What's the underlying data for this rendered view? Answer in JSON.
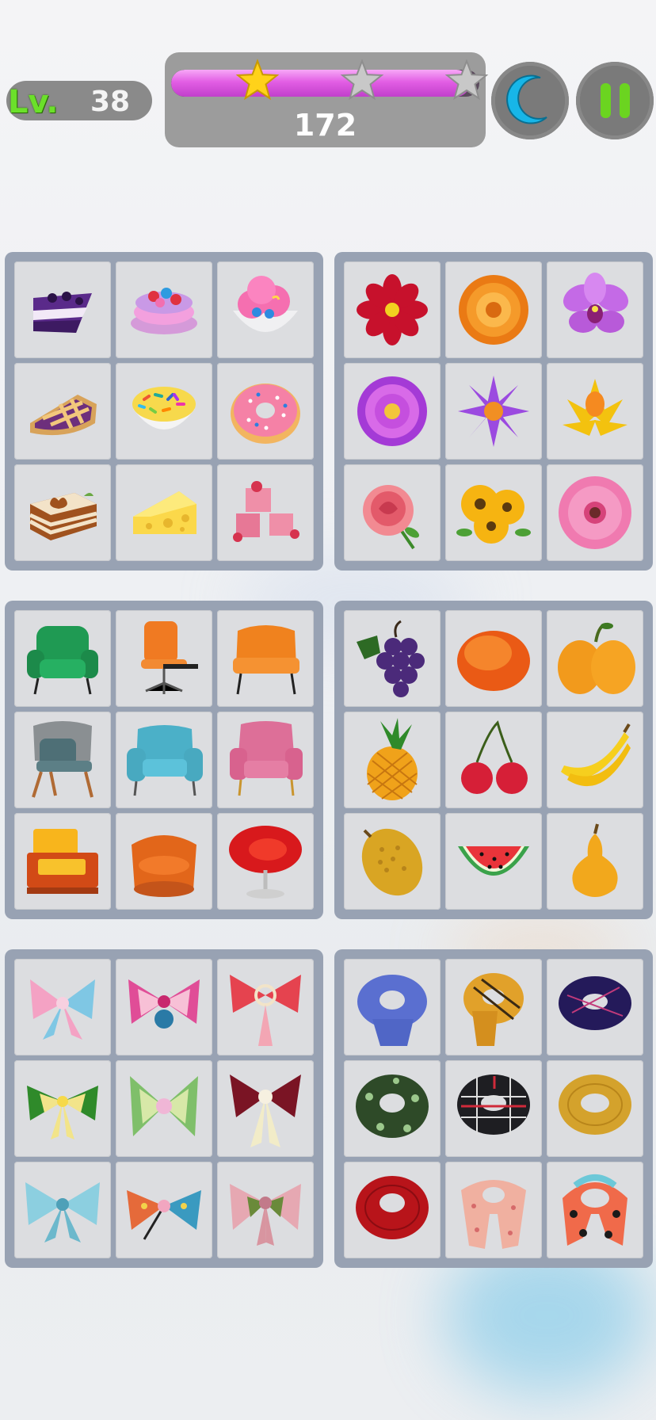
{
  "hud": {
    "level_prefix": "Lv.",
    "level_number": "38",
    "score": "172",
    "progress_fraction": 0.97,
    "stars": [
      {
        "earned": true,
        "at": 0.28
      },
      {
        "earned": false,
        "at": 0.62
      },
      {
        "earned": false,
        "at": 0.96
      }
    ],
    "hint_button": "moon-icon",
    "pause_button": "pause-icon"
  },
  "boards": [
    {
      "category": "desserts",
      "items": [
        "berry-cake",
        "macaron",
        "ice-cream-bowl",
        "pie",
        "sprinkles-bowl",
        "donut",
        "tiramisu",
        "cheese",
        "jelly-cubes"
      ]
    },
    {
      "category": "flowers",
      "items": [
        "red-dahlia",
        "orange-chrysanthemum",
        "purple-orchid",
        "violet-dahlia",
        "purple-lotus",
        "yellow-lotus",
        "pink-rose",
        "yellow-daisies",
        "pink-gerbera"
      ]
    },
    {
      "category": "chairs",
      "items": [
        "green-armchair",
        "office-chair",
        "orange-lounge-chair",
        "grey-lounge-chair",
        "blue-armchair",
        "pink-armchair",
        "yellow-sofa-chair",
        "orange-barrel-chair",
        "red-egg-chair"
      ]
    },
    {
      "category": "fruits",
      "items": [
        "grapes",
        "mango",
        "kumquats",
        "pineapple",
        "cherries",
        "bananas",
        "durian",
        "watermelon-slice",
        "pear"
      ]
    },
    {
      "category": "bows",
      "items": [
        "pastel-bow",
        "pink-bell-bow",
        "red-tassel-bow",
        "green-bow",
        "green-lace-bow",
        "burgundy-bow",
        "blue-bow",
        "patterned-bow",
        "pink-checked-bow"
      ]
    },
    {
      "category": "scarves",
      "items": [
        "blue-scarf",
        "mustard-scarf",
        "navy-scarf",
        "green-paisley-scarf",
        "plaid-scarf",
        "yellow-knit-scarf",
        "red-knit-scarf",
        "peach-floral-scarf",
        "polka-scarf"
      ]
    }
  ],
  "colors": {
    "progress": "#e25ee4",
    "level_text": "#6be02a",
    "moon": "#17b6e8",
    "pause": "#6bd420",
    "star_gold": "#ffd21a",
    "star_grey": "#c8c8c8"
  }
}
